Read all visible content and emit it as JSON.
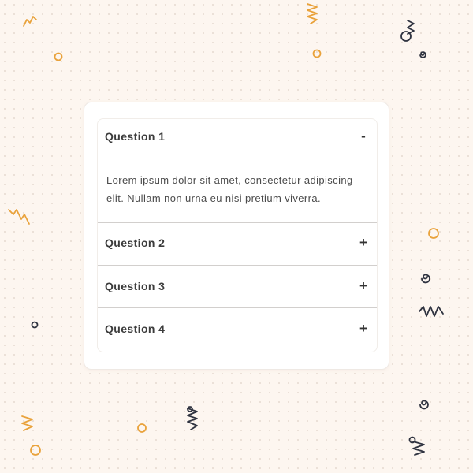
{
  "faq": {
    "items": [
      {
        "title": "Question 1",
        "toggle": "-",
        "expanded": true,
        "body": "Lorem ipsum dolor sit amet, consectetur adipiscing elit. Nullam non urna eu nisi pretium viverra."
      },
      {
        "title": "Question 2",
        "toggle": "+",
        "expanded": false
      },
      {
        "title": "Question 3",
        "toggle": "+",
        "expanded": false
      },
      {
        "title": "Question 4",
        "toggle": "+",
        "expanded": false
      }
    ]
  },
  "colors": {
    "background": "#fdf6f0",
    "decor_orange": "#e9a23b",
    "decor_dark": "#2f3340",
    "card": "#ffffff",
    "text": "#3c3c3c"
  }
}
